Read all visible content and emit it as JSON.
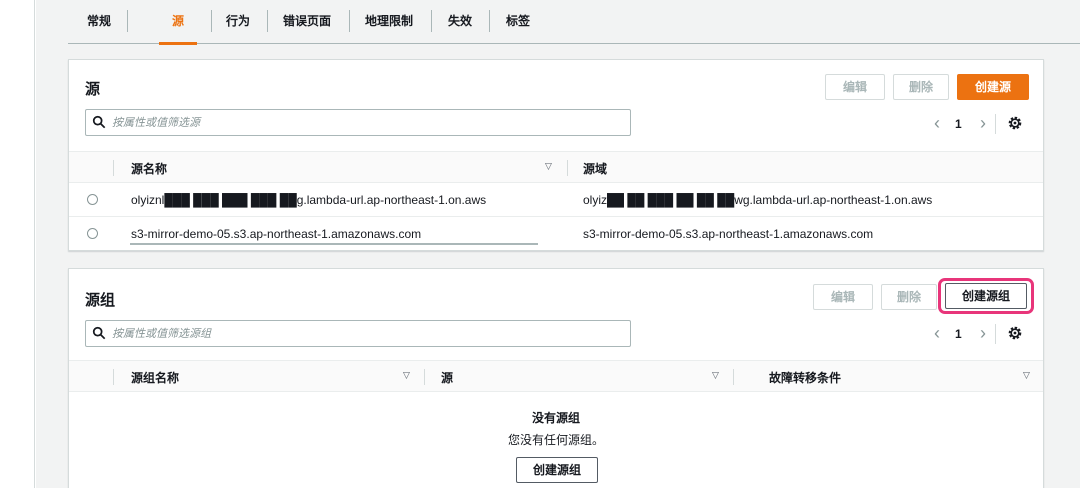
{
  "tabs": [
    {
      "label": "常规"
    },
    {
      "label": "源"
    },
    {
      "label": "行为"
    },
    {
      "label": "错误页面"
    },
    {
      "label": "地理限制"
    },
    {
      "label": "失效"
    },
    {
      "label": "标签"
    }
  ],
  "active_tab": "源",
  "origins": {
    "title": "源",
    "edit_label": "编辑",
    "delete_label": "删除",
    "create_label": "创建源",
    "search_placeholder": "按属性或值筛选源",
    "page": "1",
    "columns": [
      "源名称",
      "源域"
    ],
    "rows": [
      {
        "name": "olyiznl███ ███ ███ ███ ██g.lambda-url.ap-northeast-1.on.aws",
        "domain": "olyiz██ ██ ███ ██ ██ ██wg.lambda-url.ap-northeast-1.on.aws"
      },
      {
        "name": "s3-mirror-demo-05.s3.ap-northeast-1.amazonaws.com",
        "domain": "s3-mirror-demo-05.s3.ap-northeast-1.amazonaws.com"
      }
    ]
  },
  "origin_groups": {
    "title": "源组",
    "edit_label": "编辑",
    "delete_label": "删除",
    "create_label": "创建源组",
    "search_placeholder": "按属性或值筛选源组",
    "page": "1",
    "columns": [
      "源组名称",
      "源",
      "故障转移条件"
    ],
    "empty_title": "没有源组",
    "empty_desc": "您没有任何源组。",
    "empty_create_label": "创建源组"
  },
  "colors": {
    "accent": "#ec7211",
    "highlight": "#e8357a",
    "border": "#d5dbdb"
  },
  "icons": {
    "search": "search-icon",
    "settings": "gear-icon",
    "prev": "chevron-left-icon",
    "next": "chevron-right-icon",
    "sort": "caret-down-icon"
  }
}
